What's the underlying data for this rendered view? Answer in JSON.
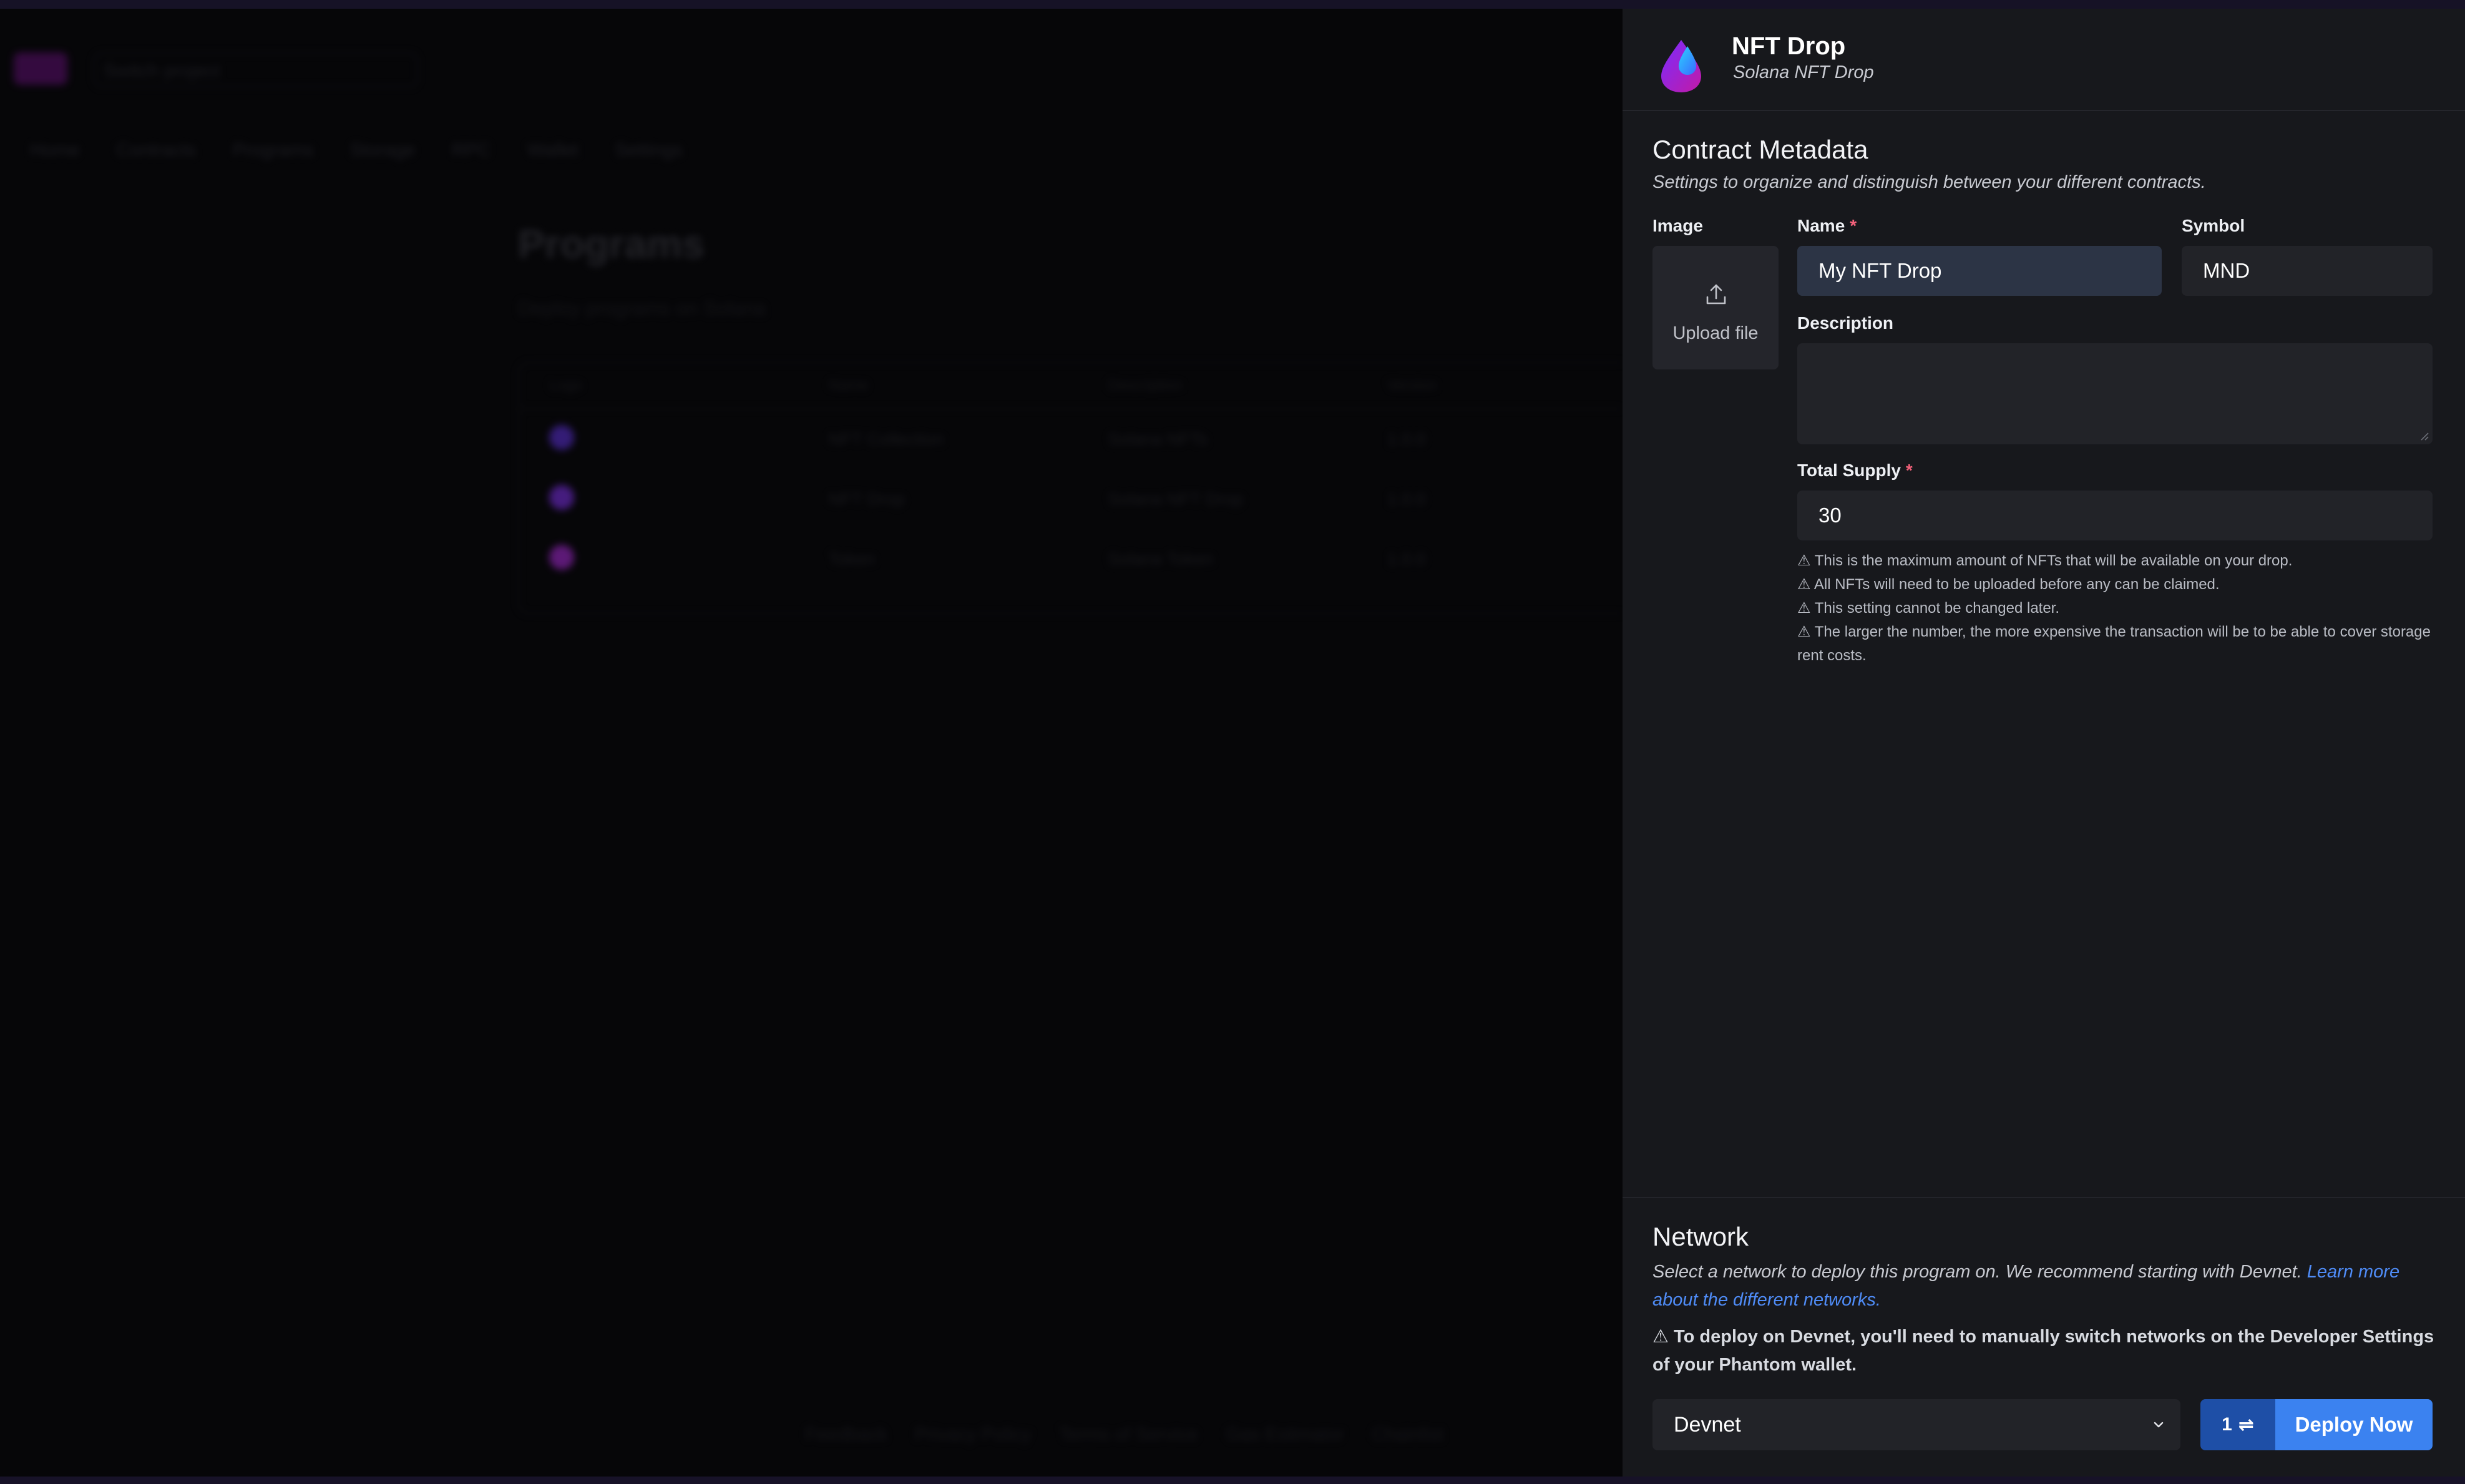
{
  "background": {
    "project_placeholder": "Switch project",
    "nav": [
      "Home",
      "Contracts",
      "Programs",
      "Storage",
      "RPC",
      "Wallet",
      "Settings"
    ],
    "page_title": "Programs",
    "page_subtitle": "Deploy programs on Solana",
    "table_headers": [
      "Logo",
      "Name",
      "Description",
      "Version"
    ],
    "rows": [
      {
        "name": "NFT Collection",
        "description": "Solana NFTs",
        "version": "1.0.0",
        "color": "#5a2fd0"
      },
      {
        "name": "NFT Drop",
        "description": "Solana NFT Drop",
        "version": "1.0.0",
        "color": "#7a2fe0"
      },
      {
        "name": "Token",
        "description": "Solana Token",
        "version": "1.0.0",
        "color": "#a32ad0"
      }
    ],
    "footer_links": [
      "Feedback",
      "Privacy Policy",
      "Terms of Service",
      "Gas Estimator",
      "Chainlist"
    ]
  },
  "drawer": {
    "title": "NFT Drop",
    "subtitle": "Solana NFT Drop",
    "metadata": {
      "title": "Contract Metadata",
      "description": "Settings to organize and distinguish between your different contracts.",
      "image_label": "Image",
      "upload_label": "Upload file",
      "name_label": "Name",
      "name_value": "My NFT Drop",
      "symbol_label": "Symbol",
      "symbol_value": "MND",
      "description_label": "Description",
      "description_value": "",
      "supply_label": "Total Supply",
      "supply_value": "30",
      "required_mark": "*",
      "warnings": [
        "⚠ This is the maximum amount of NFTs that will be available on your drop.",
        "⚠ All NFTs will need to be uploaded before any can be claimed.",
        "⚠ This setting cannot be changed later.",
        "⚠ The larger the number, the more expensive the transaction will be to be able to cover storage rent costs."
      ]
    },
    "network": {
      "title": "Network",
      "description": "Select a network to deploy this program on. We recommend starting with Devnet.",
      "learn_more": "Learn more about the different networks.",
      "notice": "⚠ To deploy on Devnet, you'll need to manually switch networks on the Developer Settings of your Phantom wallet.",
      "selected": "Devnet",
      "pair_count": "1",
      "pair_icon": "⇌",
      "deploy_label": "Deploy Now"
    }
  },
  "colors": {
    "accent": "#3b82f0",
    "drawer_bg": "#17181c",
    "required": "#f3617a"
  }
}
